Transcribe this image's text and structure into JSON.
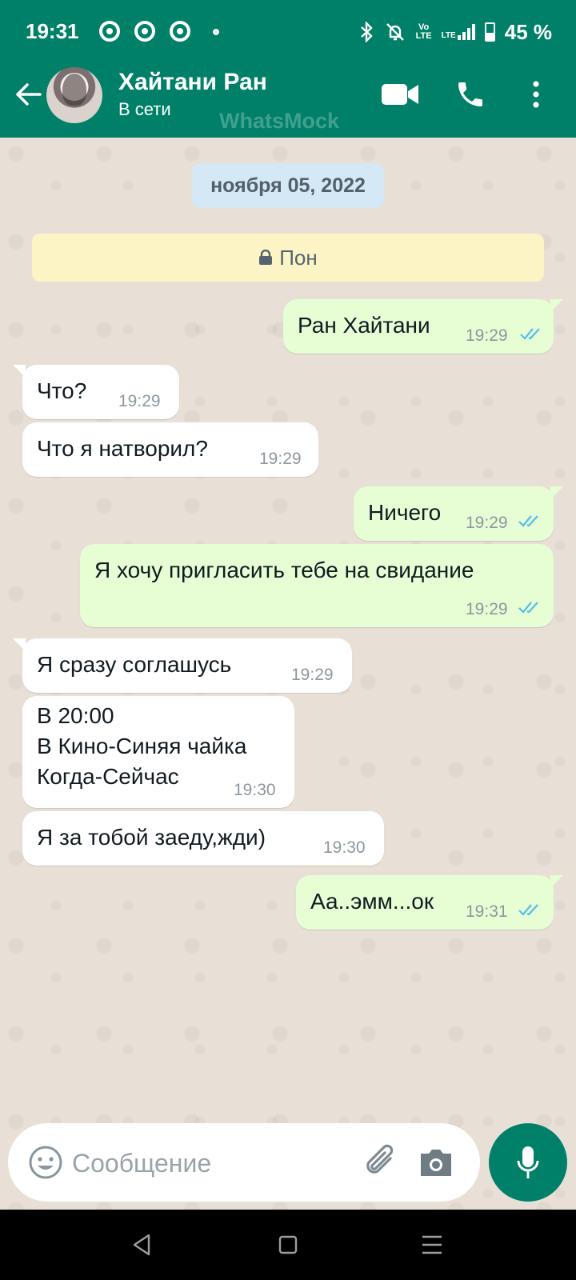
{
  "status_bar": {
    "time": "19:31",
    "network_small": "Vo\nLTE",
    "lte": "LTE",
    "battery": "45 %"
  },
  "header": {
    "contact_name": "Хайтани Ран",
    "status": "В сети",
    "watermark": "WhatsMock"
  },
  "chat": {
    "date_chip": "ноября 05, 2022",
    "lock_banner": "Пон",
    "messages": [
      {
        "dir": "out",
        "text": "Ран Хайтани",
        "time": "19:29"
      },
      {
        "dir": "in",
        "text": "Что?",
        "time": "19:29"
      },
      {
        "dir": "in",
        "text": "Что я натворил?",
        "time": "19:29"
      },
      {
        "dir": "out",
        "text": "Ничего",
        "time": "19:29"
      },
      {
        "dir": "out",
        "text": "Я хочу пригласить тебе на свидание",
        "time": "19:29"
      },
      {
        "dir": "in",
        "text": "Я сразу соглашусь",
        "time": "19:29"
      },
      {
        "dir": "in",
        "text": "В 20:00\nВ Кино-Синяя чайка\nКогда-Сейчас",
        "time": "19:30"
      },
      {
        "dir": "in",
        "text": "Я за тобой заеду,жди)",
        "time": "19:30"
      },
      {
        "dir": "out",
        "text": "Аа..эмм...ок",
        "time": "19:31"
      }
    ]
  },
  "composer": {
    "placeholder": "Сообщение"
  },
  "colors": {
    "header": "#008069",
    "outgoing_bubble": "#e7fed5",
    "incoming_bubble": "#ffffff",
    "read_check": "#53bdeb"
  }
}
